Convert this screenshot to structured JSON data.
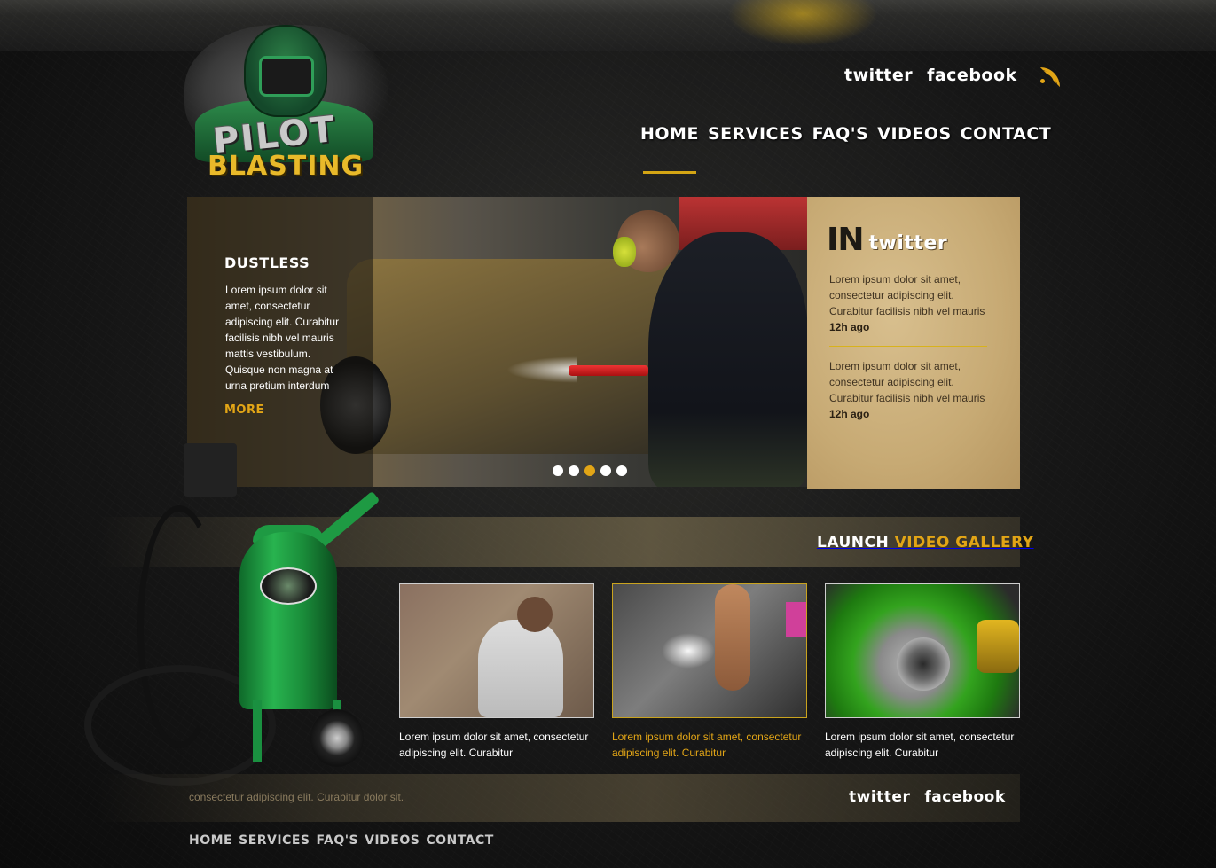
{
  "brand": {
    "line1": "PILOT",
    "line2": "BLASTING"
  },
  "header": {
    "social": {
      "twitter": "twitter",
      "facebook": "facebook"
    },
    "nav": [
      "HOME",
      "SERVICES",
      "FAQ'S",
      "VIDEOS",
      "CONTACT"
    ]
  },
  "slider": {
    "title": "DUSTLESS",
    "text": "Lorem ipsum dolor sit amet, consectetur adipiscing elit. Curabitur facilisis nibh vel mauris mattis vestibulum. Quisque non magna at urna pretium interdum",
    "more": "MORE",
    "slide_count": 5,
    "active_slide": 3
  },
  "twitter_panel": {
    "title_in": "IN",
    "title_twitter": "twitter",
    "tweets": [
      {
        "text": "Lorem ipsum dolor sit amet, consectetur adipiscing elit. Curabitur facilisis nibh vel mauris",
        "time": "12h ago"
      },
      {
        "text": "Lorem ipsum dolor sit amet, consectetur adipiscing elit. Curabitur facilisis nibh vel mauris",
        "time": "12h ago"
      }
    ]
  },
  "gallery": {
    "launch": "LAUNCH",
    "video_gallery": "VIDEO GALLERY",
    "items": [
      {
        "caption": "Lorem ipsum dolor sit amet, consectetur adipiscing elit. Curabitur"
      },
      {
        "caption": "Lorem ipsum dolor sit amet, consectetur adipiscing elit. Curabitur"
      },
      {
        "caption": "Lorem ipsum dolor sit amet, consectetur adipiscing elit. Curabitur"
      }
    ]
  },
  "footer": {
    "text": "consectetur adipiscing elit. Curabitur dolor sit.",
    "social": {
      "twitter": "twitter",
      "facebook": "facebook"
    },
    "nav": [
      "HOME",
      "SERVICES",
      "FAQ'S",
      "VIDEOS",
      "CONTACT"
    ]
  },
  "colors": {
    "accent": "#e2a516",
    "panel": "#c7aa74",
    "green": "#28b34f"
  }
}
